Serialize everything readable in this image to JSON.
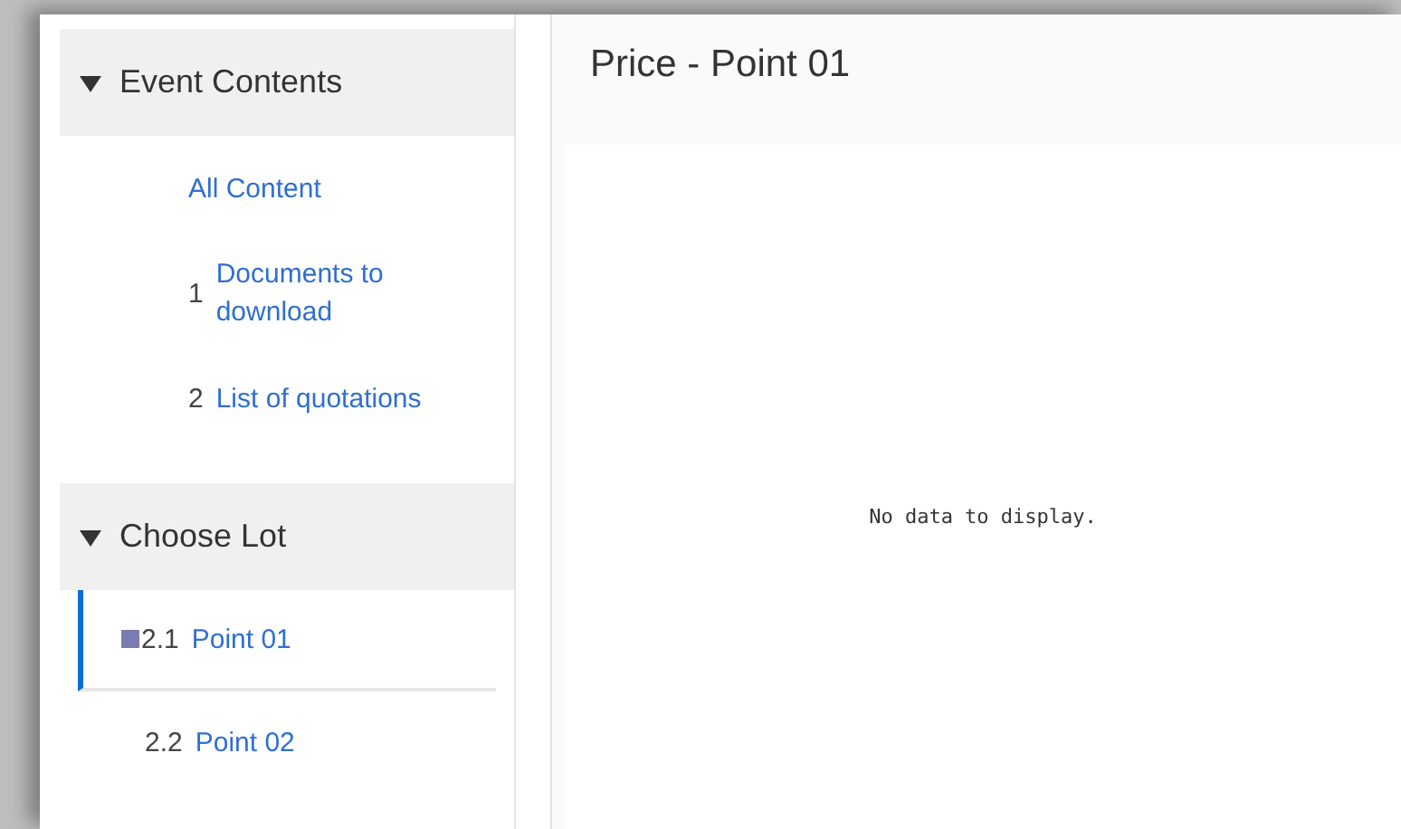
{
  "sidebar": {
    "sections": [
      {
        "title": "Event Contents",
        "expanded": true,
        "items": [
          {
            "label": "All Content",
            "selected": false
          },
          {
            "number": "1",
            "label": "Documents to download",
            "selected": false
          },
          {
            "number": "2",
            "label": "List of quotations",
            "selected": false
          }
        ]
      },
      {
        "title": "Choose Lot",
        "expanded": true,
        "items": [
          {
            "number": "2.1",
            "label": "Point 01",
            "selected": true
          },
          {
            "number": "2.2",
            "label": "Point 02",
            "selected": false
          }
        ]
      }
    ]
  },
  "main": {
    "title": "Price - Point 01",
    "empty_message": "No data to display."
  }
}
